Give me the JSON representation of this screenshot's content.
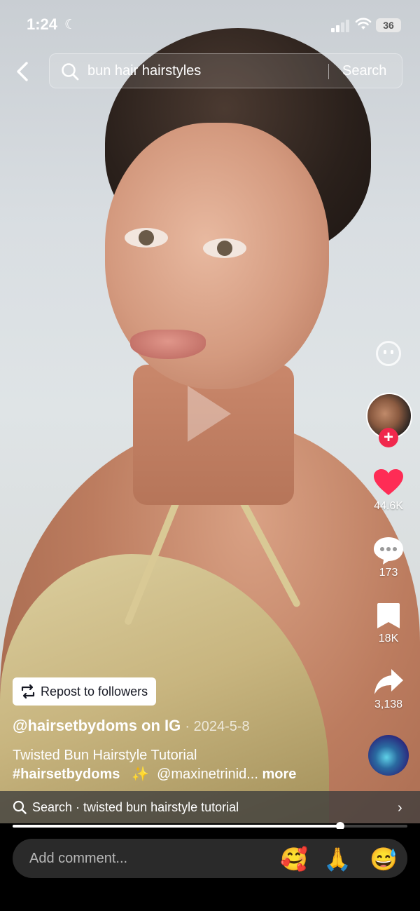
{
  "status_bar": {
    "time": "1:24",
    "battery": "36"
  },
  "search": {
    "query": "bun hair hairstyles",
    "button": "Search"
  },
  "rail": {
    "likes": "44.6K",
    "comments": "173",
    "saves": "18K",
    "shares": "3,138"
  },
  "repost": {
    "label": "Repost to followers"
  },
  "post": {
    "author": "@hairsetbydoms on IG",
    "date": "2024-5-8",
    "caption_line1": "Twisted Bun Hairstyle Tutorial",
    "hashtag": "#hairsetbydoms",
    "sparkle": "✨",
    "mention": "@maxinetrinid...",
    "more": "more"
  },
  "related_search": {
    "prefix": "Search",
    "query": "twisted bun hairstyle tutorial"
  },
  "playback": {
    "progress": 0.83
  },
  "comment_bar": {
    "placeholder": "Add comment...",
    "emojis": [
      "🥰",
      "🙏",
      "😅"
    ]
  }
}
